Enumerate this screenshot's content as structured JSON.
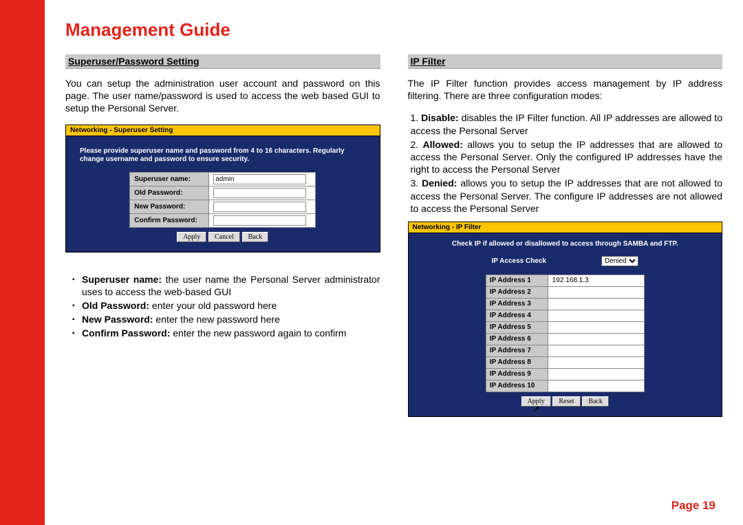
{
  "title": "Management Guide",
  "page_label": "Page 19",
  "left": {
    "heading": "Superuser/Password Setting",
    "intro": "You can setup the administration user account and password on this page. The user name/password is used to access the web based GUI to setup the Personal Server.",
    "sshot": {
      "titlebar": "Networking - Superuser Setting",
      "instruction": "Please provide superuser name and password from 4 to 16 characters. Regularly change username and password to ensure security.",
      "rows": [
        {
          "label": "Superuser name:",
          "value": "admin"
        },
        {
          "label": "Old Password:",
          "value": ""
        },
        {
          "label": "New Password:",
          "value": ""
        },
        {
          "label": "Confirm Password:",
          "value": ""
        }
      ],
      "buttons": [
        "Apply",
        "Cancel",
        "Back"
      ]
    },
    "bullets": [
      {
        "bold": "Superuser name:",
        "rest": " the user name the Personal Server administrator uses to access the web-based GUI"
      },
      {
        "bold": "Old Password:",
        "rest": " enter your old password here"
      },
      {
        "bold": "New Password:",
        "rest": " enter the new password here"
      },
      {
        "bold": "Confirm Password:",
        "rest": " enter the new password again to confirm"
      }
    ]
  },
  "right": {
    "heading": "IP Filter",
    "intro": "The IP Filter function provides access management by IP address filtering. There are three configuration modes:",
    "modes": [
      {
        "bold": "Disable:",
        "rest": " disables the IP Filter function. All IP addresses are allowed to access the Personal Server"
      },
      {
        "bold": "Allowed:",
        "rest": " allows you to setup the IP addresses that are allowed to access the Personal Server. Only the configured IP addresses have the right to access the Personal Server"
      },
      {
        "bold": "Denied:",
        "rest": " allows you to setup the IP addresses that are not allowed to access the Personal Server. The configure IP addresses are not allowed to access the Personal Server"
      }
    ],
    "sshot": {
      "titlebar": "Networking - IP Filter",
      "instruction": "Check IP if allowed or disallowed to access through SAMBA and FTP.",
      "access_label": "IP Access Check",
      "access_value": "Denied",
      "rows": [
        {
          "label": "IP Address 1",
          "value": "192.168.1.3"
        },
        {
          "label": "IP Address 2",
          "value": ""
        },
        {
          "label": "IP Address 3",
          "value": ""
        },
        {
          "label": "IP Address 4",
          "value": ""
        },
        {
          "label": "IP Address 5",
          "value": ""
        },
        {
          "label": "IP Address 6",
          "value": ""
        },
        {
          "label": "IP Address 7",
          "value": ""
        },
        {
          "label": "IP Address 8",
          "value": ""
        },
        {
          "label": "IP Address 9",
          "value": ""
        },
        {
          "label": "IP Address 10",
          "value": ""
        }
      ],
      "buttons": [
        "Apply",
        "Reset",
        "Back"
      ]
    }
  }
}
